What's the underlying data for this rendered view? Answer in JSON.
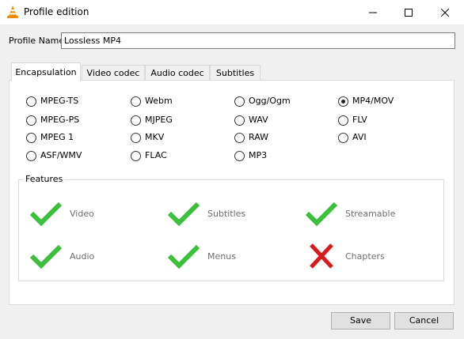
{
  "window": {
    "title": "Profile edition",
    "icons": {
      "app": "vlc-cone-icon",
      "minimize": "minimize-icon",
      "maximize": "maximize-icon",
      "close": "close-icon"
    }
  },
  "profile": {
    "label": "Profile Name",
    "value": "Lossless MP4"
  },
  "tabs": [
    {
      "label": "Encapsulation",
      "active": true
    },
    {
      "label": "Video codec",
      "active": false
    },
    {
      "label": "Audio codec",
      "active": false
    },
    {
      "label": "Subtitles",
      "active": false
    }
  ],
  "formats": [
    {
      "label": "MPEG-TS",
      "selected": false
    },
    {
      "label": "Webm",
      "selected": false
    },
    {
      "label": "Ogg/Ogm",
      "selected": false
    },
    {
      "label": "MP4/MOV",
      "selected": true
    },
    {
      "label": "MPEG-PS",
      "selected": false
    },
    {
      "label": "MJPEG",
      "selected": false
    },
    {
      "label": "WAV",
      "selected": false
    },
    {
      "label": "FLV",
      "selected": false
    },
    {
      "label": "MPEG 1",
      "selected": false
    },
    {
      "label": "MKV",
      "selected": false
    },
    {
      "label": "RAW",
      "selected": false
    },
    {
      "label": "AVI",
      "selected": false
    },
    {
      "label": "ASF/WMV",
      "selected": false
    },
    {
      "label": "FLAC",
      "selected": false
    },
    {
      "label": "MP3",
      "selected": false
    }
  ],
  "features": {
    "title": "Features",
    "items": [
      {
        "label": "Video",
        "supported": true
      },
      {
        "label": "Subtitles",
        "supported": true
      },
      {
        "label": "Streamable",
        "supported": true
      },
      {
        "label": "Audio",
        "supported": true
      },
      {
        "label": "Menus",
        "supported": true
      },
      {
        "label": "Chapters",
        "supported": false
      }
    ]
  },
  "colors": {
    "check": "#3cbf3c",
    "cross": "#d91a1a"
  },
  "buttons": {
    "save": "Save",
    "cancel": "Cancel"
  }
}
